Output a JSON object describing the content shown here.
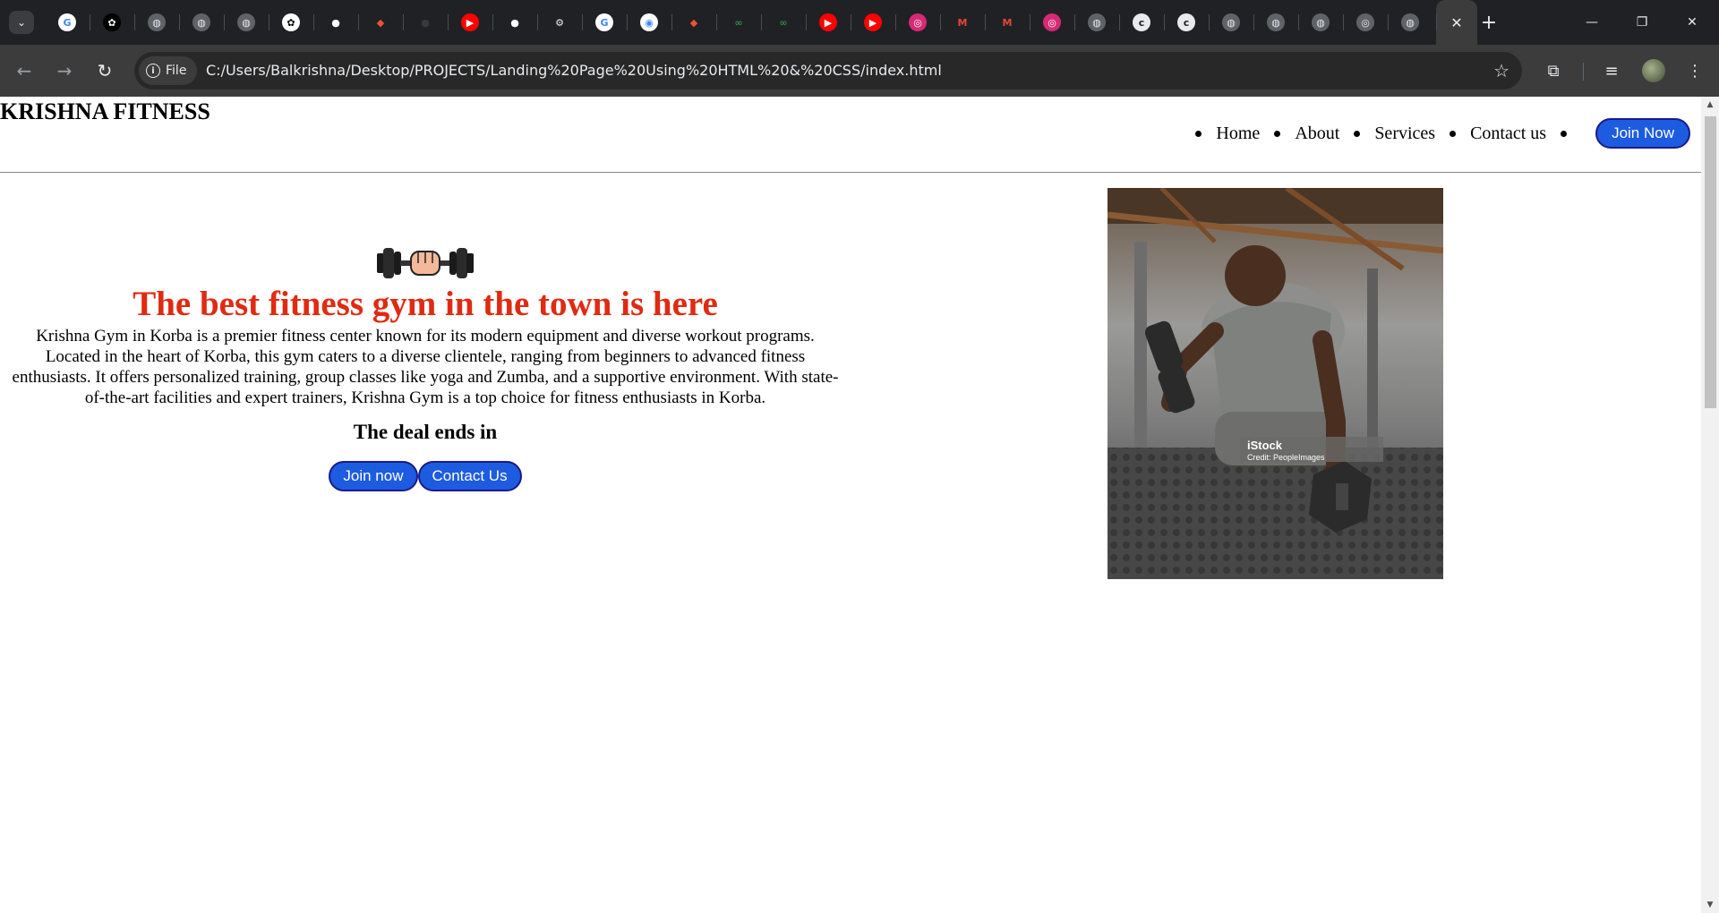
{
  "browser": {
    "tab_search_label": "⌄",
    "tabs": [
      {
        "icon": "google-icon",
        "label": "G",
        "color": "#ffffff",
        "text": "#4285f4"
      },
      {
        "icon": "chatgpt-icon",
        "label": "✿",
        "color": "#000000",
        "text": "#ffffff"
      },
      {
        "icon": "globe-icon",
        "label": "◍",
        "color": "#5f6368",
        "text": "#e8eaed"
      },
      {
        "icon": "globe-icon",
        "label": "◍",
        "color": "#5f6368",
        "text": "#e8eaed"
      },
      {
        "icon": "globe-icon",
        "label": "◍",
        "color": "#5f6368",
        "text": "#e8eaed"
      },
      {
        "icon": "chatgpt-icon",
        "label": "✿",
        "color": "#ffffff",
        "text": "#000000"
      },
      {
        "icon": "github-icon",
        "label": "●",
        "color": "#202124",
        "text": "#ffffff"
      },
      {
        "icon": "git-icon",
        "label": "◆",
        "color": "#202124",
        "text": "#f05033"
      },
      {
        "icon": "github-icon",
        "label": "●",
        "color": "#202124",
        "text": "#3a3a3a"
      },
      {
        "icon": "youtube-icon",
        "label": "▶",
        "color": "#ff0000",
        "text": "#ffffff"
      },
      {
        "icon": "github-icon",
        "label": "●",
        "color": "#202124",
        "text": "#ffffff"
      },
      {
        "icon": "settings-icon",
        "label": "⚙",
        "color": "#202124",
        "text": "#e8eaed"
      },
      {
        "icon": "google-icon",
        "label": "G",
        "color": "#ffffff",
        "text": "#4285f4"
      },
      {
        "icon": "google-lens-icon",
        "label": "◉",
        "color": "#ffffff",
        "text": "#4285f4"
      },
      {
        "icon": "git-icon",
        "label": "◆",
        "color": "#202124",
        "text": "#f05033"
      },
      {
        "icon": "geeksforgeeks-icon",
        "label": "∞",
        "color": "#202124",
        "text": "#2f8d46"
      },
      {
        "icon": "geeksforgeeks-icon",
        "label": "∞",
        "color": "#202124",
        "text": "#2f8d46"
      },
      {
        "icon": "youtube-icon",
        "label": "▶",
        "color": "#ff0000",
        "text": "#ffffff"
      },
      {
        "icon": "youtube-icon",
        "label": "▶",
        "color": "#ff0000",
        "text": "#ffffff"
      },
      {
        "icon": "instagram-icon",
        "label": "◎",
        "color": "#d62976",
        "text": "#ffffff"
      },
      {
        "icon": "gmail-icon",
        "label": "M",
        "color": "#202124",
        "text": "#ea4335"
      },
      {
        "icon": "gmail-icon",
        "label": "M",
        "color": "#202124",
        "text": "#ea4335"
      },
      {
        "icon": "instagram-icon",
        "label": "◎",
        "color": "#d62976",
        "text": "#ffffff"
      },
      {
        "icon": "globe-icon",
        "label": "◍",
        "color": "#5f6368",
        "text": "#e8eaed"
      },
      {
        "icon": "c-letter-icon",
        "label": "c",
        "color": "#e8eaed",
        "text": "#202124"
      },
      {
        "icon": "c-letter-icon",
        "label": "c",
        "color": "#e8eaed",
        "text": "#202124"
      },
      {
        "icon": "globe-icon",
        "label": "◍",
        "color": "#5f6368",
        "text": "#e8eaed"
      },
      {
        "icon": "globe-icon",
        "label": "◍",
        "color": "#5f6368",
        "text": "#e8eaed"
      },
      {
        "icon": "globe-icon",
        "label": "◍",
        "color": "#5f6368",
        "text": "#e8eaed"
      },
      {
        "icon": "chromium-icon",
        "label": "◎",
        "color": "#5f6368",
        "text": "#e8eaed"
      },
      {
        "icon": "globe-icon",
        "label": "◍",
        "color": "#5f6368",
        "text": "#e8eaed"
      }
    ],
    "active_tab_close": "✕",
    "new_tab": "+",
    "window_controls": {
      "minimize": "—",
      "restore": "❐",
      "close": "✕"
    },
    "nav": {
      "back": "←",
      "forward": "→",
      "reload": "↻"
    },
    "site_chip": "File",
    "url": "C:/Users/Balkrishna/Desktop/PROJECTS/Landing%20Page%20Using%20HTML%20&%20CSS/index.html",
    "bookmark_star": "☆",
    "toolbar_icons": {
      "extensions": "⧉",
      "media": "≡",
      "menu": "⋮"
    }
  },
  "page": {
    "brand": "KRISHNA FITNESS",
    "nav_items": [
      "Home",
      "About",
      "Services",
      "Contact us"
    ],
    "join_nav_label": "Join Now",
    "headline": "The best fitness gym in the town is here",
    "description": "Krishna Gym in Korba is a premier fitness center known for its modern equipment and diverse workout programs. Located in the heart of Korba, this gym caters to a diverse clientele, ranging from beginners to advanced fitness enthusiasts. It offers personalized training, group classes like yoga and Zumba, and a supportive environment. With state-of-the-art facilities and expert trainers, Krishna Gym is a top choice for fitness enthusiasts in Korba.",
    "deal_text": "The deal ends in",
    "cta": {
      "join": "Join now",
      "contact": "Contact Us"
    },
    "photo": {
      "watermark": "iStock",
      "credit": "Credit: PeopleImages"
    },
    "colors": {
      "headline": "#e02a12",
      "button": "#1d5be0",
      "button_border": "#1a1a8c"
    }
  },
  "scrollbar": {
    "up": "▲",
    "down": "▼"
  }
}
